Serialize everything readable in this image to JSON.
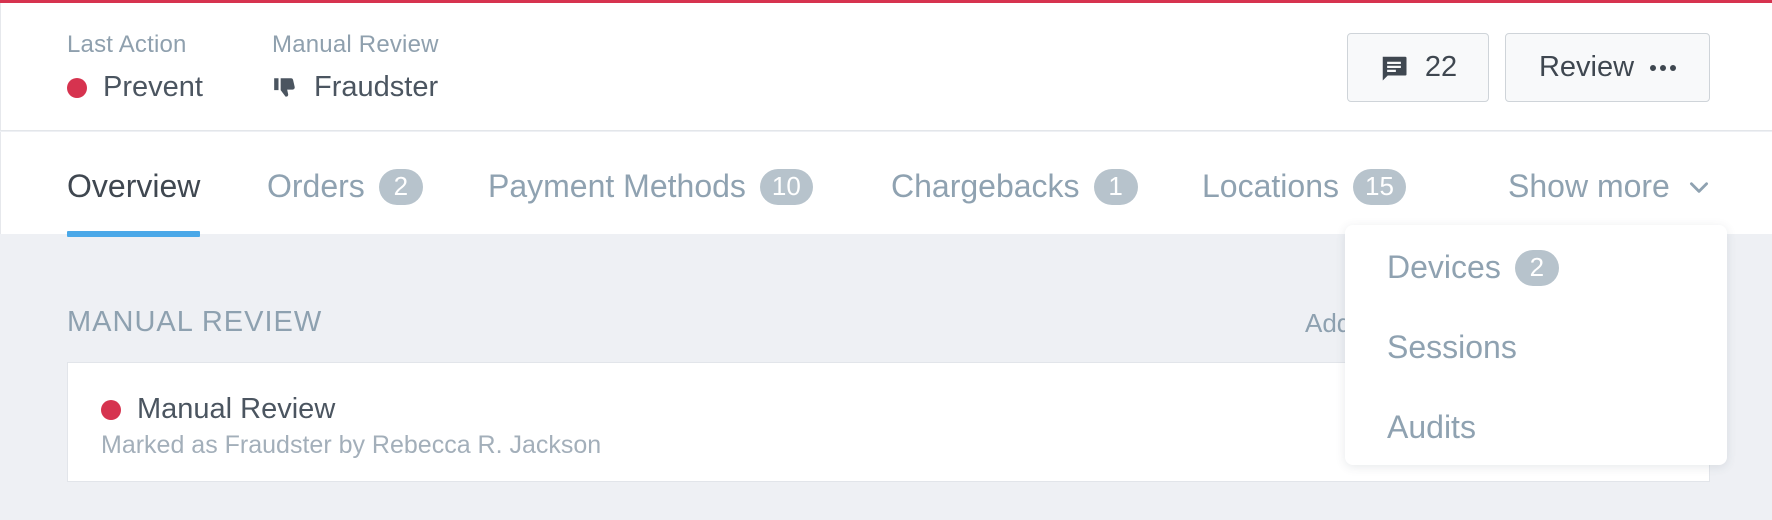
{
  "accent_color": "#d6334f",
  "tab_active_color": "#4aa8e8",
  "header": {
    "last_action": {
      "label": "Last Action",
      "value": "Prevent",
      "status_color": "#d6334f",
      "icon": "status-dot"
    },
    "manual_review": {
      "label": "Manual Review",
      "value": "Fraudster",
      "icon": "thumbs-down-icon"
    }
  },
  "actions": {
    "comments": {
      "count": "22",
      "icon": "comment-icon"
    },
    "review": {
      "label": "Review",
      "icon": "ellipsis-icon"
    }
  },
  "tabs": [
    {
      "label": "Overview",
      "badge": null,
      "active": true
    },
    {
      "label": "Orders",
      "badge": "2",
      "active": false
    },
    {
      "label": "Payment Methods",
      "badge": "10",
      "active": false
    },
    {
      "label": "Chargebacks",
      "badge": "1",
      "active": false
    },
    {
      "label": "Locations",
      "badge": "15",
      "active": false
    }
  ],
  "show_more": {
    "label": "Show more",
    "icon": "chevron-down-icon",
    "items": [
      {
        "label": "Devices",
        "badge": "2"
      },
      {
        "label": "Sessions",
        "badge": null
      },
      {
        "label": "Audits",
        "badge": null
      }
    ]
  },
  "section": {
    "title": "MANUAL REVIEW",
    "link_partial": "Add"
  },
  "review_card": {
    "title": "Manual Review",
    "subtitle": "Marked as Fraudster by Rebecca R. Jackson",
    "status_color": "#d6334f"
  }
}
